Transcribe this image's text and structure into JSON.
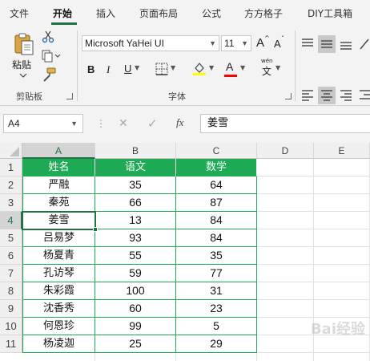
{
  "menu": {
    "tabs": [
      {
        "label": "文件"
      },
      {
        "label": "开始",
        "active": true
      },
      {
        "label": "插入"
      },
      {
        "label": "页面布局"
      },
      {
        "label": "公式"
      },
      {
        "label": "方方格子"
      },
      {
        "label": "DIY工具箱"
      }
    ]
  },
  "ribbon": {
    "clipboard": {
      "paste_label": "粘贴",
      "group_label": "剪贴板",
      "icons": [
        "paste-icon",
        "cut-icon",
        "copy-icon",
        "format-painter-icon"
      ]
    },
    "font": {
      "font_name": "Microsoft YaHei UI",
      "font_size": "11",
      "grow_font": "A",
      "shrink_font": "A",
      "bold": "B",
      "italic": "I",
      "underline": "U",
      "font_color_glyph": "A",
      "phonetic_label": "wén",
      "phonetic_glyph": "文",
      "group_label": "字体",
      "highlight_color": "#ffff00",
      "font_color": "#ff0000"
    },
    "alignment": {
      "icons": [
        "align-top-icon",
        "align-middle-icon",
        "align-bottom-icon",
        "align-left-icon",
        "align-center-icon",
        "align-right-icon"
      ]
    }
  },
  "formula_bar": {
    "name_box": "A4",
    "cancel_glyph": "✕",
    "enter_glyph": "✓",
    "fx_label": "fx",
    "formula": "姜雪"
  },
  "sheet": {
    "columns": [
      "A",
      "B",
      "C",
      "D",
      "E"
    ],
    "rows": [
      "1",
      "2",
      "3",
      "4",
      "5",
      "6",
      "7",
      "8",
      "9",
      "10",
      "11"
    ],
    "selected_cell": "A4",
    "header_color": "#1faa55",
    "headers": [
      "姓名",
      "语文",
      "数学"
    ],
    "data": [
      [
        "严融",
        "35",
        "64"
      ],
      [
        "秦苑",
        "66",
        "87"
      ],
      [
        "姜雪",
        "13",
        "84"
      ],
      [
        "吕易梦",
        "93",
        "84"
      ],
      [
        "杨夏青",
        "55",
        "35"
      ],
      [
        "孔访琴",
        "59",
        "77"
      ],
      [
        "朱彩霞",
        "100",
        "31"
      ],
      [
        "沈香秀",
        "60",
        "23"
      ],
      [
        "何恩珍",
        "99",
        "5"
      ],
      [
        "杨凌迦",
        "25",
        "29"
      ]
    ]
  },
  "watermark": "Bai经验"
}
